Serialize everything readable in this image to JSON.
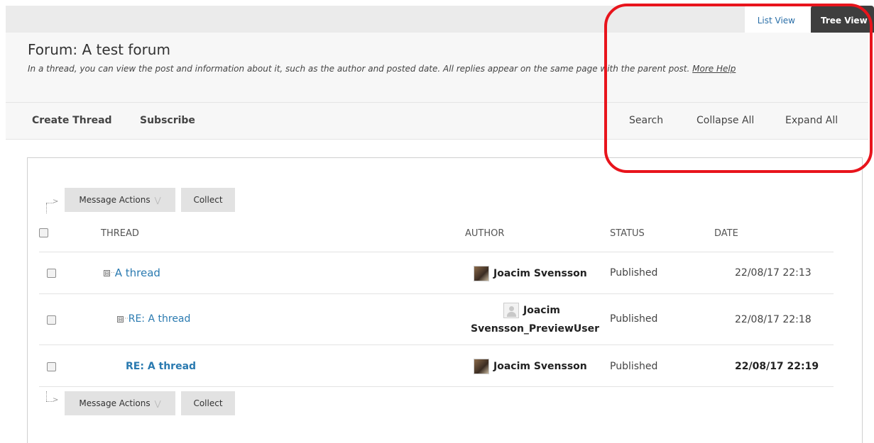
{
  "view_switch": {
    "list_view": "List View",
    "tree_view": "Tree View"
  },
  "forum": {
    "title": "Forum: A test forum",
    "description": "In a thread, you can view the post and information about it, such as the author and posted date. All replies appear on the same page with the parent post.",
    "more_help": "More Help"
  },
  "actions": {
    "create_thread": "Create Thread",
    "subscribe": "Subscribe",
    "search": "Search",
    "collapse_all": "Collapse All",
    "expand_all": "Expand All"
  },
  "buttons": {
    "message_actions": "Message Actions",
    "collect": "Collect"
  },
  "columns": {
    "thread": "THREAD",
    "author": "AUTHOR",
    "status": "STATUS",
    "date": "DATE"
  },
  "rows": [
    {
      "thread": "A thread",
      "author": "Joacim Svensson",
      "status": "Published",
      "date": "22/08/17 22:13"
    },
    {
      "thread": "RE: A thread",
      "author_line1": "Joacim",
      "author_line2": "Svensson_PreviewUser",
      "status": "Published",
      "date": "22/08/17 22:18"
    },
    {
      "thread": "RE: A thread",
      "author": "Joacim Svensson",
      "status": "Published",
      "date": "22/08/17 22:19"
    }
  ],
  "icons": {
    "expand_box": "⊟",
    "dropdown_chevron": "chevron-down-icon",
    "avatar_photo": "user-photo-icon",
    "avatar_generic": "user-generic-icon"
  },
  "colors": {
    "link": "#2a7ab0",
    "highlight": "#e8141c",
    "active_tab": "#3e3e3e"
  }
}
